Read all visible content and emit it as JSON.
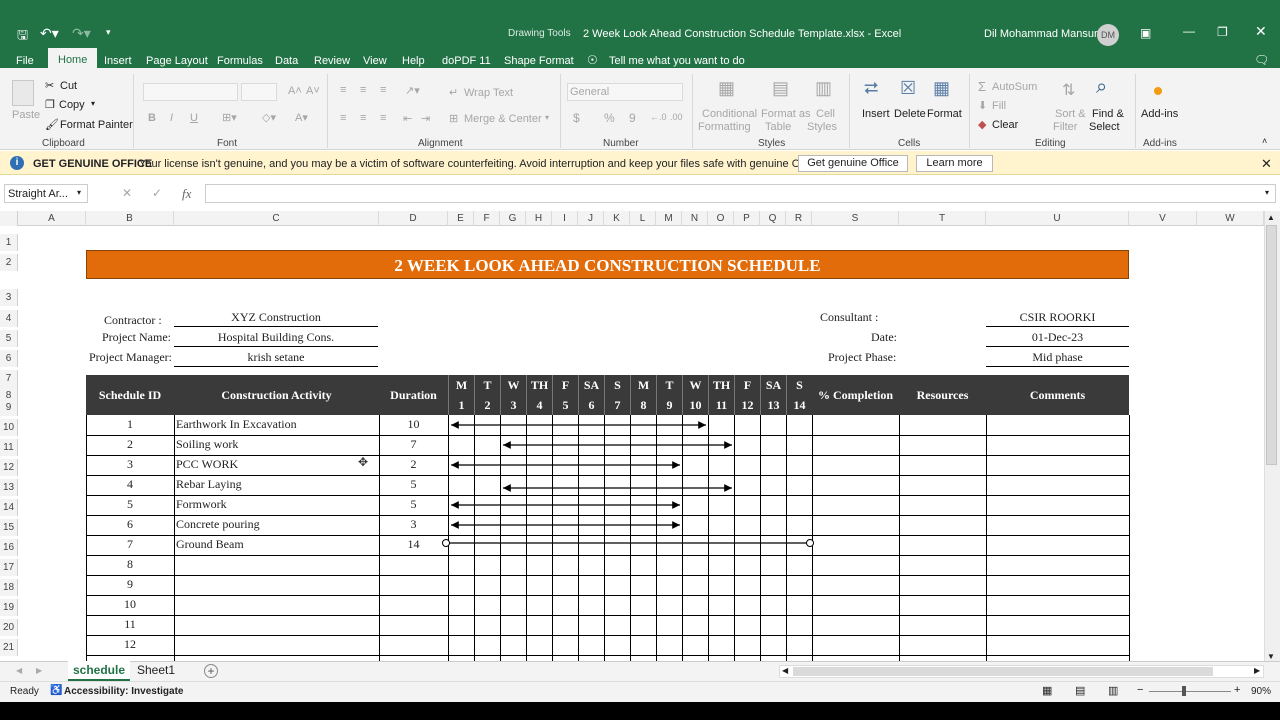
{
  "titlebar": {
    "context_label": "Drawing Tools",
    "file_title": "2 Week Look Ahead Construction Schedule Template.xlsx  -  Excel",
    "user_name": "Dil Mohammad Mansuri",
    "user_initials": "DM"
  },
  "tabs": [
    "File",
    "Home",
    "Insert",
    "Page Layout",
    "Formulas",
    "Data",
    "Review",
    "View",
    "Help",
    "doPDF 11",
    "Shape Format"
  ],
  "active_tab": "Home",
  "tell_me": "Tell me what you want to do",
  "ribbon": {
    "clipboard": {
      "paste": "Paste",
      "cut": "Cut",
      "copy": "Copy",
      "format_painter": "Format Painter",
      "label": "Clipboard"
    },
    "font": {
      "label": "Font",
      "bold": "B",
      "italic": "I",
      "underline": "U"
    },
    "alignment": {
      "wrap_text": "Wrap Text",
      "merge_center": "Merge & Center",
      "label": "Alignment"
    },
    "number": {
      "format_value": "General",
      "label": "Number",
      "currency": "$",
      "percent": "%",
      "comma": "9"
    },
    "styles": {
      "conditional": "Conditional",
      "formatting": "Formatting",
      "format_as": "Format as",
      "table": "Table",
      "cell": "Cell",
      "styles_btn": "Styles",
      "label": "Styles"
    },
    "cells": {
      "insert": "Insert",
      "delete": "Delete",
      "format": "Format",
      "label": "Cells"
    },
    "editing": {
      "autosum": "AutoSum",
      "fill": "Fill",
      "clear": "Clear",
      "sort": "Sort &",
      "filter": "Filter",
      "find": "Find &",
      "select": "Select",
      "label": "Editing"
    },
    "addins": {
      "button": "Add-ins",
      "label": "Add-ins"
    }
  },
  "message_bar": {
    "title": "GET GENUINE OFFICE",
    "text": "Your license isn't genuine, and you may be a victim of software counterfeiting. Avoid interruption and keep your files safe with genuine Office today.",
    "btn_genuine": "Get genuine Office",
    "btn_learn": "Learn more"
  },
  "formula_bar": {
    "name_box": "Straight Ar...",
    "fx": "fx",
    "formula": ""
  },
  "columns": [
    "A",
    "B",
    "C",
    "D",
    "E",
    "F",
    "G",
    "H",
    "I",
    "J",
    "K",
    "L",
    "M",
    "N",
    "O",
    "P",
    "Q",
    "R",
    "S",
    "T",
    "U",
    "V",
    "W"
  ],
  "rows": [
    "1",
    "2",
    "3",
    "4",
    "5",
    "6",
    "7",
    "8",
    "9",
    "10",
    "11",
    "12",
    "13",
    "14",
    "15",
    "16",
    "17",
    "18",
    "19",
    "20",
    "21"
  ],
  "sheet": {
    "title": "2 WEEK LOOK AHEAD CONSTRUCTION SCHEDULE",
    "contractor_label": "Contractor    :",
    "contractor_value": "XYZ Construction",
    "project_name_label": "Project Name:",
    "project_name_value": "Hospital Building Cons.",
    "project_manager_label": "Project Manager:",
    "project_manager_value": "krish setane",
    "consultant_label": "Consultant       :",
    "consultant_value": "CSIR ROORKI",
    "date_label": "Date:",
    "date_value": "01-Dec-23",
    "phase_label": "Project Phase:",
    "phase_value": "Mid phase",
    "headers": {
      "id": "Schedule ID",
      "activity": "Construction Activity",
      "duration": "Duration",
      "completion": "% Completion",
      "resources": "Resources",
      "comments": "Comments"
    },
    "days": [
      "M",
      "T",
      "W",
      "TH",
      "F",
      "SA",
      "S",
      "M",
      "T",
      "W",
      "TH",
      "F",
      "SA",
      "S"
    ],
    "day_numbers": [
      "1",
      "2",
      "3",
      "4",
      "5",
      "6",
      "7",
      "8",
      "9",
      "10",
      "11",
      "12",
      "13",
      "14"
    ],
    "tasks": [
      {
        "id": "1",
        "activity": "Earthwork In Excavation",
        "duration": "10"
      },
      {
        "id": "2",
        "activity": "Soiling work",
        "duration": "7"
      },
      {
        "id": "3",
        "activity": "PCC WORK",
        "duration": "2"
      },
      {
        "id": "4",
        "activity": "Rebar Laying",
        "duration": "5"
      },
      {
        "id": "5",
        "activity": "Formwork",
        "duration": "5"
      },
      {
        "id": "6",
        "activity": "Concrete pouring",
        "duration": "3"
      },
      {
        "id": "7",
        "activity": "Ground Beam",
        "duration": "14"
      },
      {
        "id": "8",
        "activity": "",
        "duration": ""
      },
      {
        "id": "9",
        "activity": "",
        "duration": ""
      },
      {
        "id": "10",
        "activity": "",
        "duration": ""
      },
      {
        "id": "11",
        "activity": "",
        "duration": ""
      },
      {
        "id": "12",
        "activity": "",
        "duration": ""
      }
    ]
  },
  "sheet_tabs": [
    "schedule",
    "Sheet1"
  ],
  "active_sheet": "schedule",
  "status": {
    "ready": "Ready",
    "accessibility": "Accessibility: Investigate",
    "zoom": "90%"
  },
  "colors": {
    "excel_green": "#217346",
    "title_orange": "#e36c0a",
    "header_dark": "#3a3a3a"
  }
}
